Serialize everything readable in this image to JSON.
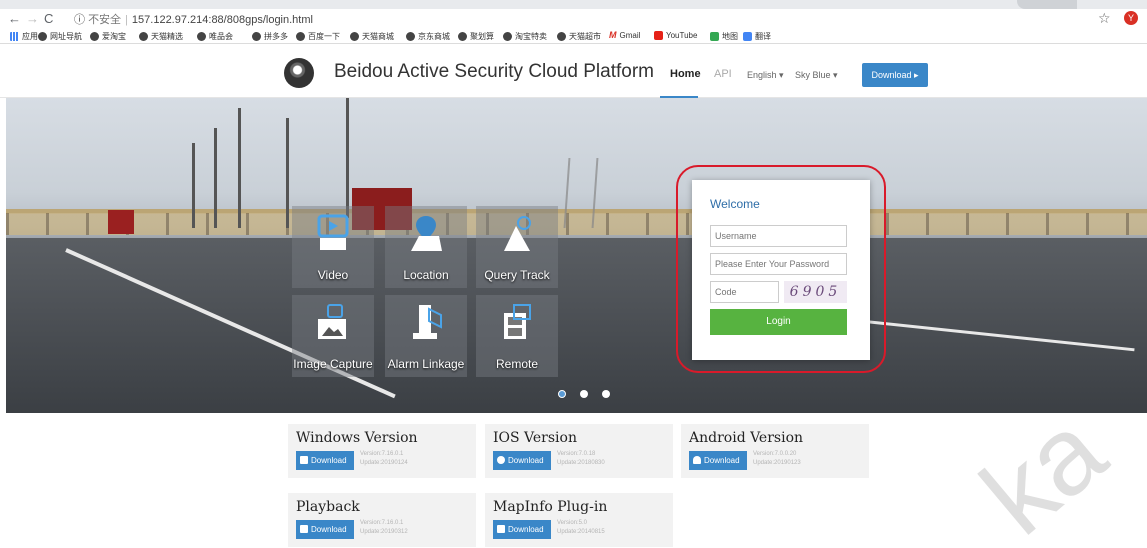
{
  "browser": {
    "url_security": "不安全",
    "url": "157.122.97.214:88/808gps/login.html",
    "profile_initial": "Y",
    "bookmarks": [
      "应用",
      "网址导航",
      "爱淘宝",
      "天猫精选",
      "唯品会",
      "拼多多",
      "百度一下",
      "天猫商城",
      "京东商城",
      "聚划算",
      "淘宝特卖",
      "天猫超市",
      "Gmail",
      "YouTube",
      "地图",
      "翻译"
    ]
  },
  "header": {
    "site_title": "Beidou Active Security Cloud Platform",
    "nav": {
      "home": "Home",
      "api": "API",
      "language": "English",
      "theme": "Sky Blue",
      "download": "Download"
    }
  },
  "features": [
    {
      "label": "Video",
      "icon": "video-icon"
    },
    {
      "label": "Location",
      "icon": "location-pin-icon"
    },
    {
      "label": "Query Track",
      "icon": "track-icon"
    },
    {
      "label": "Image Capture",
      "icon": "camera-icon"
    },
    {
      "label": "Alarm Linkage",
      "icon": "alarm-icon"
    },
    {
      "label": "Remote",
      "icon": "remote-icon"
    }
  ],
  "login": {
    "welcome": "Welcome",
    "username_placeholder": "Username",
    "password_placeholder": "Please Enter Your Password",
    "code_placeholder": "Code",
    "captcha": "6905",
    "button": "Login"
  },
  "downloads": [
    {
      "title": "Windows Version",
      "button": "Download",
      "version": "Version:7.16.0.1",
      "update": "Update:20190124"
    },
    {
      "title": "IOS Version",
      "button": "Download",
      "version": "Version:7.0.18",
      "update": "Update:20180830"
    },
    {
      "title": "Android Version",
      "button": "Download",
      "version": "Version:7.0.0.20",
      "update": "Update:20190123"
    },
    {
      "title": "Playback",
      "button": "Download",
      "version": "Version:7.16.0.1",
      "update": "Update:20190312"
    },
    {
      "title": "MapInfo Plug-in",
      "button": "Download",
      "version": "Version:5.0",
      "update": "Update:20140815"
    }
  ],
  "carousel": {
    "slides": 3,
    "active": 1
  },
  "watermark": "ka",
  "colors": {
    "accent": "#3a87c8",
    "login_button": "#57b340",
    "highlight": "#d91a2a"
  }
}
